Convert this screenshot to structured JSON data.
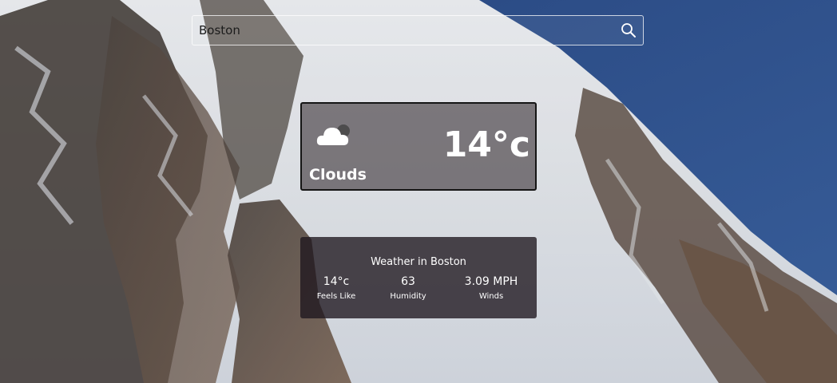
{
  "search": {
    "value": "Boston",
    "icon": "search-icon"
  },
  "current": {
    "condition": "Clouds",
    "condition_icon": "cloud-icon",
    "temperature": "14°c"
  },
  "details": {
    "heading": "Weather in Boston",
    "feels_like": {
      "value": "14°c",
      "label": "Feels Like"
    },
    "humidity": {
      "value": "63",
      "label": "Humidity"
    },
    "winds": {
      "value": "3.09 MPH",
      "label": "Winds"
    }
  },
  "colors": {
    "sky": "#2d4f8a",
    "snow": "#e9edf2",
    "rock": "#6b5a4e"
  }
}
